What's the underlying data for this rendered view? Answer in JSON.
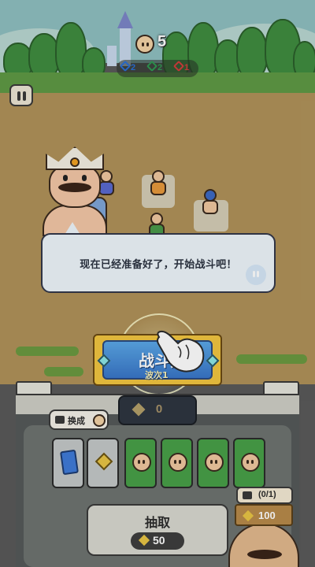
{
  "hud": {
    "coin_count": "5",
    "stats": [
      {
        "icon": "key-icon",
        "value": "2",
        "color": "#2a6fd6"
      },
      {
        "icon": "shield-icon",
        "value": "2",
        "color": "#2f9a52"
      },
      {
        "icon": "sword-icon",
        "value": "1",
        "color": "#d33b3b"
      }
    ]
  },
  "dialog": {
    "text": "现在已经准备好了，开始战斗吧！"
  },
  "battle_button": {
    "label": "战斗开",
    "wave": "波次1"
  },
  "panel": {
    "energy": "0",
    "swap_label": "换成",
    "slots": [
      {
        "type": "card",
        "icon": "card-icon"
      },
      {
        "type": "gem",
        "icon": "gem-icon"
      },
      {
        "type": "unit",
        "icon": "coin-face-icon"
      },
      {
        "type": "unit",
        "icon": "coin-face-icon"
      },
      {
        "type": "unit",
        "icon": "coin-face-icon"
      },
      {
        "type": "unit",
        "icon": "coin-face-icon"
      }
    ],
    "draw": {
      "label": "抽取",
      "cost": "50"
    },
    "ad": {
      "count": "(0/1)",
      "price": "100"
    }
  },
  "colors": {
    "field": "#b0925a",
    "wall": "#555a5a",
    "slot_green": "#48a048",
    "battle_blue": "#3976c8",
    "battle_gold": "#f2c640"
  }
}
